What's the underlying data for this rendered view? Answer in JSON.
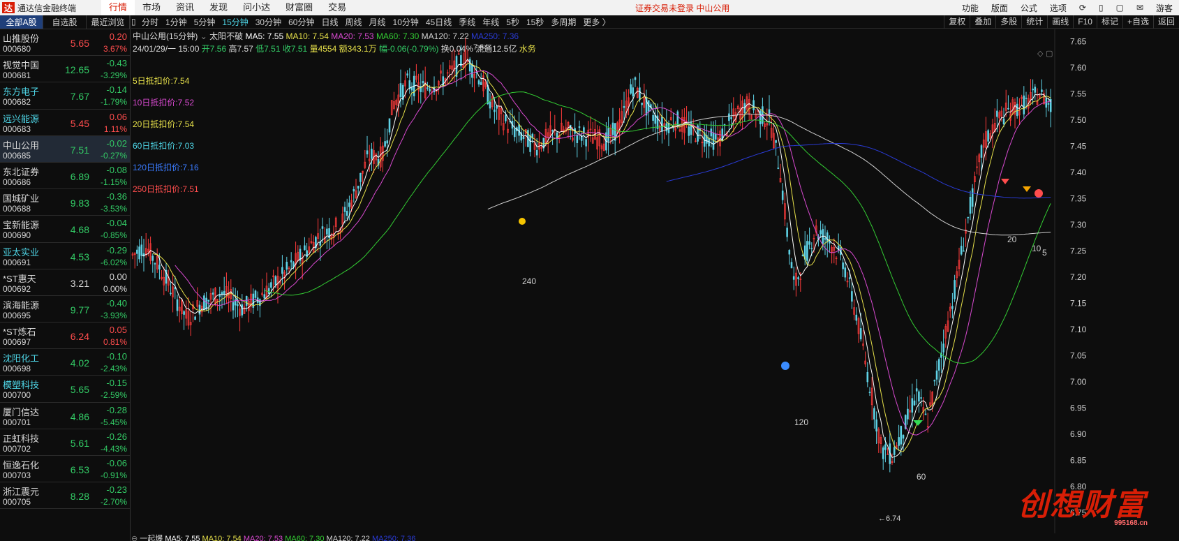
{
  "menubar": {
    "app_name": "通达信金融终端",
    "logo_char": "达",
    "items": [
      "行情",
      "市场",
      "资讯",
      "发现",
      "问小达",
      "财富圈",
      "交易"
    ],
    "notice": "证券交易未登录   中山公用",
    "right_items": [
      "功能",
      "版面",
      "公式",
      "选项"
    ],
    "guest": "游客"
  },
  "left": {
    "tabs": [
      "全部A股",
      "自选股",
      "最近浏览"
    ],
    "stocks": [
      {
        "name": "山推股份",
        "code": "000680",
        "price": "5.65",
        "chg": "0.20",
        "pct": "3.67%",
        "dir": "up",
        "cyan": false
      },
      {
        "name": "视觉中国",
        "code": "000681",
        "price": "12.65",
        "chg": "-0.43",
        "pct": "-3.29%",
        "dir": "down",
        "cyan": false
      },
      {
        "name": "东方电子",
        "code": "000682",
        "price": "7.67",
        "chg": "-0.14",
        "pct": "-1.79%",
        "dir": "down",
        "cyan": true
      },
      {
        "name": "远兴能源",
        "code": "000683",
        "price": "5.45",
        "chg": "0.06",
        "pct": "1.11%",
        "dir": "up",
        "cyan": true
      },
      {
        "name": "中山公用",
        "code": "000685",
        "price": "7.51",
        "chg": "-0.02",
        "pct": "-0.27%",
        "dir": "down",
        "cyan": false,
        "selected": true
      },
      {
        "name": "东北证券",
        "code": "000686",
        "price": "6.89",
        "chg": "-0.08",
        "pct": "-1.15%",
        "dir": "down",
        "cyan": false
      },
      {
        "name": "国城矿业",
        "code": "000688",
        "price": "9.83",
        "chg": "-0.36",
        "pct": "-3.53%",
        "dir": "down",
        "cyan": false
      },
      {
        "name": "宝新能源",
        "code": "000690",
        "price": "4.68",
        "chg": "-0.04",
        "pct": "-0.85%",
        "dir": "down",
        "cyan": false
      },
      {
        "name": "亚太实业",
        "code": "000691",
        "price": "4.53",
        "chg": "-0.29",
        "pct": "-6.02%",
        "dir": "down",
        "cyan": true
      },
      {
        "name": "*ST惠天",
        "code": "000692",
        "price": "3.21",
        "chg": "0.00",
        "pct": "0.00%",
        "dir": "flat",
        "cyan": false
      },
      {
        "name": "滨海能源",
        "code": "000695",
        "price": "9.77",
        "chg": "-0.40",
        "pct": "-3.93%",
        "dir": "down",
        "cyan": false
      },
      {
        "name": "*ST炼石",
        "code": "000697",
        "price": "6.24",
        "chg": "0.05",
        "pct": "0.81%",
        "dir": "up",
        "cyan": false
      },
      {
        "name": "沈阳化工",
        "code": "000698",
        "price": "4.02",
        "chg": "-0.10",
        "pct": "-2.43%",
        "dir": "down",
        "cyan": true
      },
      {
        "name": "模塑科技",
        "code": "000700",
        "price": "5.65",
        "chg": "-0.15",
        "pct": "-2.59%",
        "dir": "down",
        "cyan": true
      },
      {
        "name": "厦门信达",
        "code": "000701",
        "price": "4.86",
        "chg": "-0.28",
        "pct": "-5.45%",
        "dir": "down",
        "cyan": false
      },
      {
        "name": "正虹科技",
        "code": "000702",
        "price": "5.61",
        "chg": "-0.26",
        "pct": "-4.43%",
        "dir": "down",
        "cyan": false
      },
      {
        "name": "恒逸石化",
        "code": "000703",
        "price": "6.53",
        "chg": "-0.06",
        "pct": "-0.91%",
        "dir": "down",
        "cyan": false
      },
      {
        "name": "浙江震元",
        "code": "000705",
        "price": "8.28",
        "chg": "-0.23",
        "pct": "-2.70%",
        "dir": "down",
        "cyan": false
      }
    ]
  },
  "periods": [
    "分时",
    "1分钟",
    "5分钟",
    "15分钟",
    "30分钟",
    "60分钟",
    "日线",
    "周线",
    "月线",
    "10分钟",
    "45日线",
    "季线",
    "年线",
    "5秒",
    "15秒",
    "多周期",
    "更多 〉"
  ],
  "active_period": "15分钟",
  "tools": [
    "复权",
    "叠加",
    "多股",
    "统计",
    "画线",
    "F10",
    "标记",
    "+自选",
    "返回"
  ],
  "info1": {
    "title": "中山公用(15分钟)",
    "indicator": "太阳不破",
    "ma5": "MA5: 7.55",
    "ma10": "MA10: 7.54",
    "ma20": "MA20: 7.53",
    "ma60": "MA60: 7.30",
    "ma120": "MA120: 7.22",
    "ma250": "MA250: 7.36"
  },
  "info2": {
    "date": "24/01/29/一 15:00",
    "open": "开7.56",
    "high": "高7.57",
    "low": "低7.51",
    "close": "收7.51",
    "vol": "量4554",
    "amount": "额343.1万",
    "range": "幅-0.06(-0.79%)",
    "turnover": "换0.04%",
    "float": "流通12.5亿",
    "sector": "水务"
  },
  "deduct_labels": [
    {
      "text": "5日抵扣价:7.54",
      "color": "#e6e04a"
    },
    {
      "text": "10日抵扣价:7.52",
      "color": "#d94ad1"
    },
    {
      "text": "20日抵扣价:7.54",
      "color": "#e6e04a"
    },
    {
      "text": "60日抵扣价:7.03",
      "color": "#4fd7e8"
    },
    {
      "text": "120日抵扣价:7.16",
      "color": "#3a7bff"
    },
    {
      "text": "250日抵扣价:7.51",
      "color": "#ff4d4d"
    }
  ],
  "chart_data": {
    "type": "candlestick",
    "interval": "15分钟",
    "ylim": [
      6.74,
      7.66
    ],
    "y_ticks": [
      "7.65",
      "7.60",
      "7.55",
      "7.50",
      "7.45",
      "7.40",
      "7.35",
      "7.30",
      "7.25",
      "7.20",
      "7.15",
      "7.10",
      "7.05",
      "7.00",
      "6.95",
      "6.90",
      "6.85",
      "6.80",
      "6.75"
    ],
    "high_marker": "7.64",
    "low_marker": "←6.74",
    "period_labels": [
      "240",
      "120",
      "60",
      "20",
      "10",
      "5"
    ],
    "ma_colors": {
      "ma5": "#ffffff",
      "ma10": "#e6e04a",
      "ma20": "#d94ad1",
      "ma60": "#33cc33",
      "ma120": "#d0d0d0",
      "ma250": "#2a3bd6"
    }
  },
  "bottom": {
    "name": "一起爆",
    "ma5": "MA5: 7.55",
    "ma10": "MA10: 7.54",
    "ma20": "MA20: 7.53",
    "ma60": "MA60: 7.30",
    "ma120": "MA120: 7.22",
    "ma250": "MA250: 7.36"
  },
  "watermark": {
    "text": "创想财富",
    "url": "995168.cn"
  }
}
